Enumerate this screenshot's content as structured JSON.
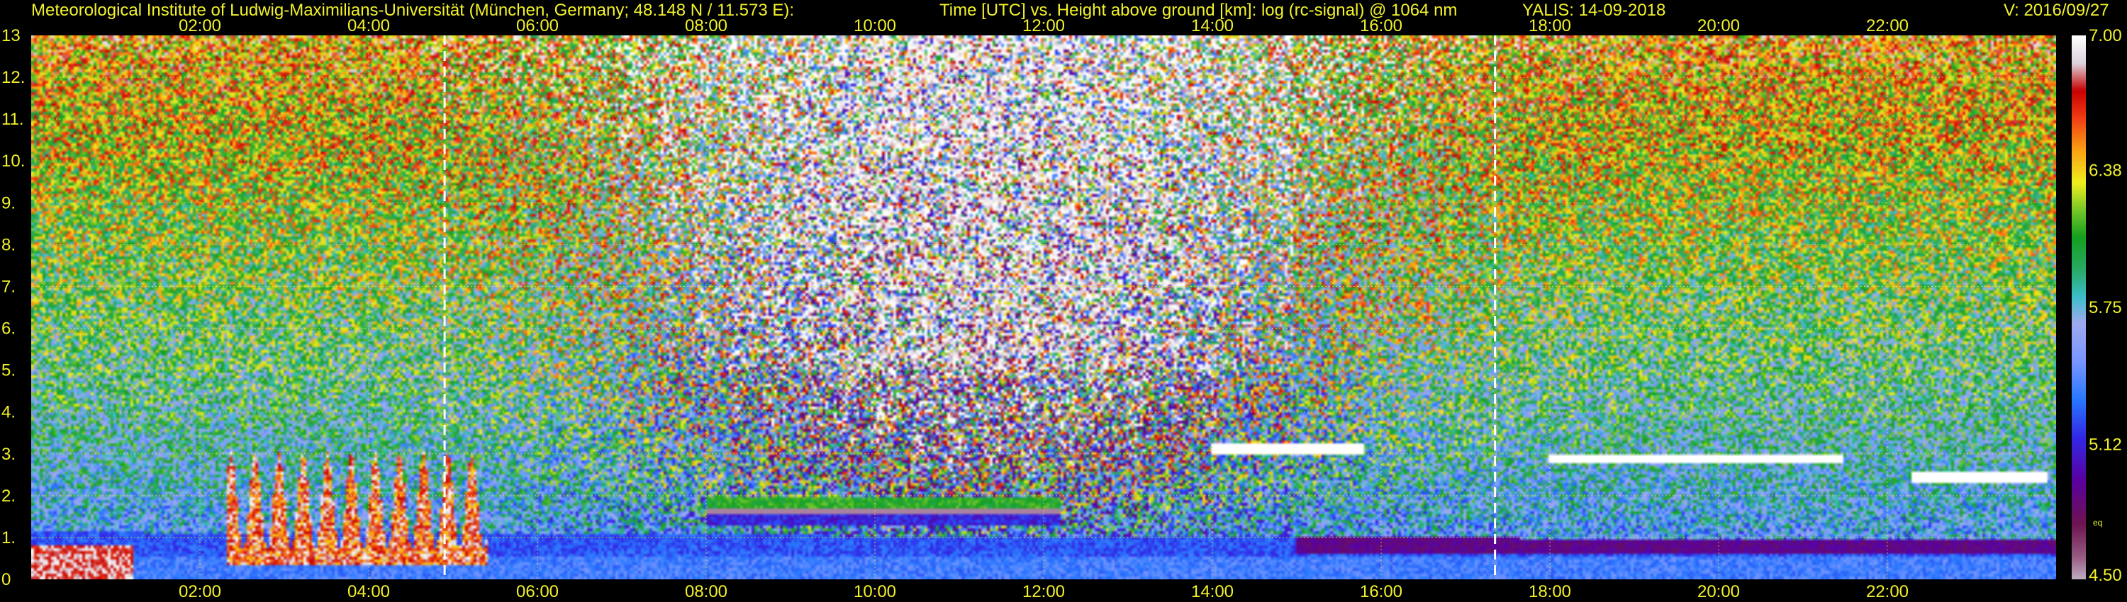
{
  "header": {
    "institute": "Meteorological Institute of Ludwig-Maximilians-Universität (München, Germany; 48.148 N / 11.573 E):",
    "title": "Time [UTC] vs. Height above ground [km]: log (rc-signal) @ 1064 nm",
    "station_date": "YALIS: 14-09-2018",
    "version": "V: 2016/09/27"
  },
  "chart_data": {
    "type": "heatmap",
    "title": "Time [UTC] vs. Height above ground [km]: log (rc-signal) @ 1064 nm",
    "x_unit": "hours UTC",
    "xlim": [
      0,
      24
    ],
    "x_ticks": [
      2,
      4,
      6,
      8,
      10,
      12,
      14,
      16,
      18,
      20,
      22
    ],
    "x_tick_labels": [
      "02:00",
      "04:00",
      "06:00",
      "08:00",
      "10:00",
      "12:00",
      "14:00",
      "16:00",
      "18:00",
      "20:00",
      "22:00"
    ],
    "y_unit": "km",
    "ylim": [
      0,
      13
    ],
    "y_ticks": [
      0,
      1,
      2,
      3,
      4,
      5,
      6,
      7,
      8,
      9,
      10,
      11,
      12,
      13
    ],
    "y_tick_labels": [
      "0",
      "1.",
      "2.",
      "3.",
      "4.",
      "5.",
      "6.",
      "7.",
      "8.",
      "9.",
      "10.",
      "11.",
      "12.",
      "13"
    ],
    "grid": true,
    "marker_lines_hours": [
      4.9,
      17.35
    ],
    "colorbar": {
      "range": [
        4.5,
        7.0
      ],
      "tick_labels": [
        "7.00",
        "6.38",
        "5.75",
        "5.12",
        "4.50"
      ],
      "tick_values": [
        7.0,
        6.38,
        5.75,
        5.12,
        4.5
      ],
      "small_label": "eq"
    },
    "features": [
      {
        "kind": "boundary-layer",
        "x": [
          0.0,
          24.0
        ],
        "y_top": [
          1.1,
          0.9
        ]
      },
      {
        "kind": "convective-plumes",
        "x": [
          2.3,
          5.4
        ],
        "y_top": 3.0
      },
      {
        "kind": "aerosol-layer",
        "x": [
          8.0,
          12.2
        ],
        "y": 1.6
      },
      {
        "kind": "cloud-layer",
        "x": [
          14.0,
          15.8
        ],
        "y": 3.1
      },
      {
        "kind": "cloud-layer",
        "x": [
          18.0,
          21.5
        ],
        "y": 2.85
      },
      {
        "kind": "cloud-layer",
        "x": [
          22.3,
          23.9
        ],
        "y": 2.4
      }
    ]
  }
}
